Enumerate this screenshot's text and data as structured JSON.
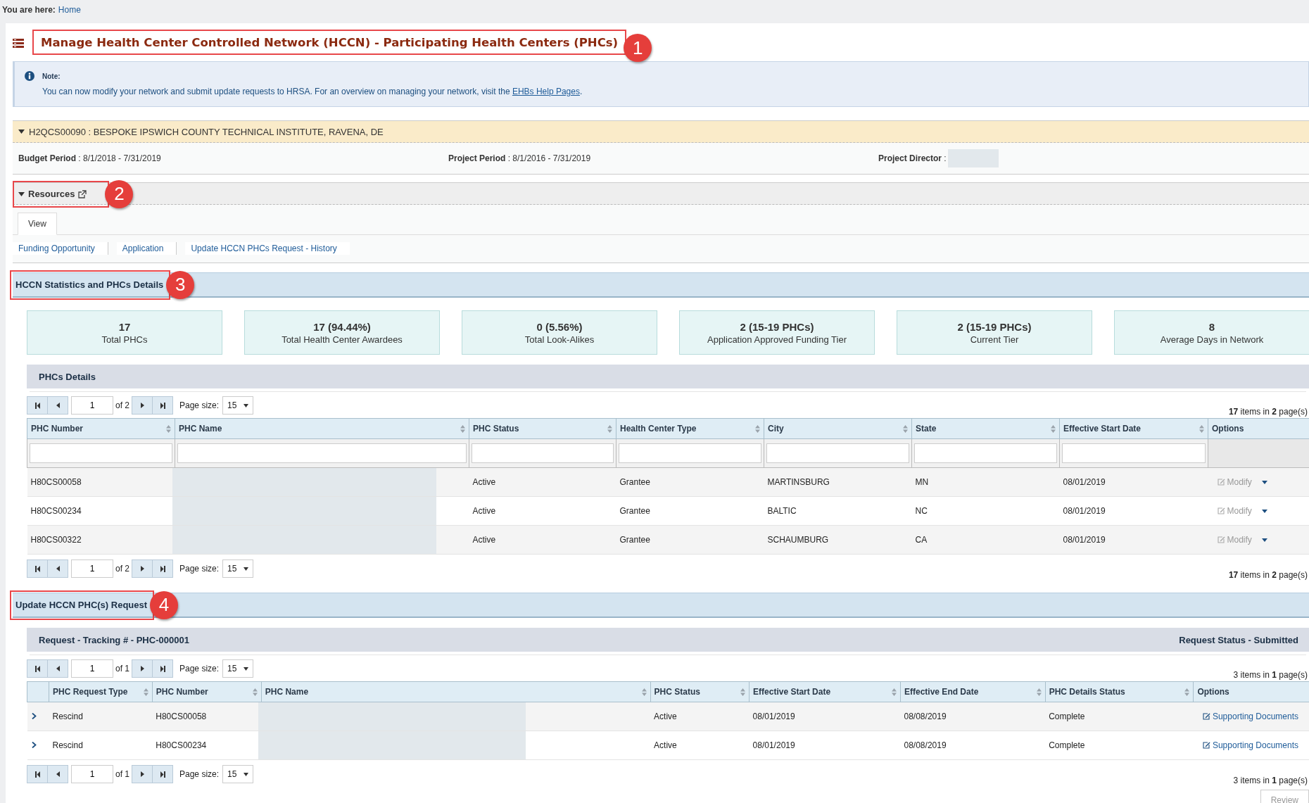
{
  "breadcrumb": {
    "label": "You are here:",
    "link": "Home"
  },
  "page_title": {
    "text": "Manage Health Center Controlled Network (HCCN) - Participating Health Centers (PHCs)",
    "callout": "1"
  },
  "note": {
    "heading": "Note:",
    "text": "You can now modify your network and submit update requests to HRSA. For an overview on managing your network, visit the",
    "link": "EHBs Help Pages",
    "end": "."
  },
  "grant": {
    "title": "H2QCS00090 : BESPOKE IPSWICH COUNTY TECHNICAL INSTITUTE, RAVENA, DE",
    "expanded": true,
    "fields": [
      {
        "text": "**Budget Period** : 8/1/2018 - 7/31/2019",
        "redacted": false
      },
      {
        "text": "**Project Period** : 8/1/2016 - 7/31/2019",
        "redacted": false
      },
      {
        "text": "**Project Director** :",
        "redacted": true
      }
    ]
  },
  "resources": {
    "title": "Resources",
    "expanded": true,
    "callout": "2",
    "tabs": [
      {
        "label": "View",
        "selected": true
      }
    ],
    "links": [
      "Funding Opportunity",
      "Application",
      "Update HCCN PHCs Request - History"
    ]
  },
  "statistics": {
    "title": "HCCN Statistics and PHCs Details",
    "callout": "3",
    "stats": [
      {
        "value": "17",
        "label": "Total PHCs"
      },
      {
        "value": "17 (94.44%)",
        "label": "Total Health Center Awardees"
      },
      {
        "value": "0 (5.56%)",
        "label": "Total Look-Alikes"
      },
      {
        "value": "2 (15-19 PHCs)",
        "label": "Application Approved Funding Tier"
      },
      {
        "value": "2 (15-19 PHCs)",
        "label": "Current Tier"
      },
      {
        "value": "8",
        "label": "Average Days in Network"
      }
    ]
  },
  "phc_details": {
    "title": "PHCs Details",
    "filterable": true,
    "pager_top": {
      "page": "1",
      "of": "of 2",
      "size_label": "Page size:",
      "size": "15",
      "info": "**17** items in **2** page(s)"
    },
    "columns": [
      {
        "label": "PHC Number",
        "kind": "text",
        "sortable": true
      },
      {
        "label": "PHC Name",
        "kind": "redacted",
        "sortable": true
      },
      {
        "label": "PHC Status",
        "kind": "text",
        "sortable": true
      },
      {
        "label": "Health Center Type",
        "kind": "text",
        "sortable": true
      },
      {
        "label": "City",
        "kind": "text",
        "sortable": true
      },
      {
        "label": "State",
        "kind": "text",
        "sortable": true
      },
      {
        "label": "Effective Start Date",
        "kind": "text",
        "sortable": true
      },
      {
        "label": "Options",
        "kind": "options",
        "sortable": false
      }
    ],
    "rows": [
      {
        "cells": [
          "H80CS00058",
          "",
          "Active",
          "Grantee",
          "MARTINSBURG",
          "MN",
          "08/01/2019"
        ],
        "option": {
          "label": "Modify",
          "disabled": true
        }
      },
      {
        "cells": [
          "H80CS00234",
          "",
          "Active",
          "Grantee",
          "BALTIC",
          "NC",
          "08/01/2019"
        ],
        "option": {
          "label": "Modify",
          "disabled": true
        }
      },
      {
        "cells": [
          "H80CS00322",
          "",
          "Active",
          "Grantee",
          "SCHAUMBURG",
          "CA",
          "08/01/2019"
        ],
        "option": {
          "label": "Modify",
          "disabled": true
        }
      }
    ],
    "pager_bottom": {
      "page": "1",
      "of": "of 2",
      "size_label": "Page size:",
      "size": "15",
      "info": "**17** items in **2** page(s)"
    }
  },
  "update_request": {
    "title": "Update HCCN PHC(s) Request",
    "callout": "4",
    "tracking": "Request - Tracking # - PHC-000001",
    "status": "Request Status - Submitted",
    "pager_top": {
      "page": "1",
      "of": "of 1",
      "size_label": "Page size:",
      "size": "15",
      "info": "3 items in **1** page(s)"
    },
    "columns": [
      {
        "label": "PHC Request Type",
        "kind": "text",
        "sortable": true
      },
      {
        "label": "PHC Number",
        "kind": "text",
        "sortable": true
      },
      {
        "label": "PHC Name",
        "kind": "redacted",
        "sortable": true
      },
      {
        "label": "PHC Status",
        "kind": "text",
        "sortable": true
      },
      {
        "label": "Effective Start Date",
        "kind": "text",
        "sortable": true
      },
      {
        "label": "Effective End Date",
        "kind": "text",
        "sortable": true
      },
      {
        "label": "PHC Details Status",
        "kind": "text",
        "sortable": true
      },
      {
        "label": "Options",
        "kind": "options",
        "sortable": false
      }
    ],
    "rows": [
      {
        "expanded": false,
        "cells": [
          "Rescind",
          "H80CS00058",
          "",
          "Active",
          "08/01/2019",
          "08/08/2019",
          "Complete"
        ],
        "option": {
          "label": "Supporting Documents",
          "disabled": false
        }
      },
      {
        "expanded": false,
        "cells": [
          "Rescind",
          "H80CS00234",
          "",
          "Active",
          "08/01/2019",
          "08/08/2019",
          "Complete"
        ],
        "option": {
          "label": "Supporting Documents",
          "disabled": false
        }
      }
    ],
    "pager_bottom": {
      "page": "1",
      "of": "of 1",
      "size_label": "Page size:",
      "size": "15",
      "info": "3 items in **1** page(s)"
    }
  },
  "review_button": {
    "label": "Review",
    "disabled": true
  }
}
